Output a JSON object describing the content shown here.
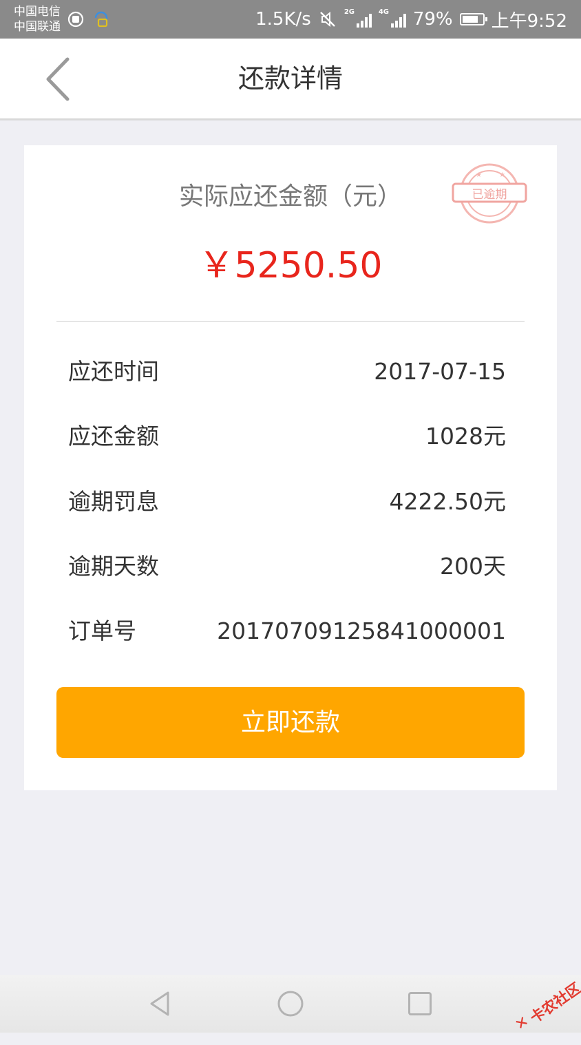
{
  "status_bar": {
    "carrier_1": "中国电信",
    "carrier_2": "中国联通",
    "speed": "1.5K/s",
    "signal_1_label": "2G",
    "signal_2_label": "4G",
    "battery_percent": "79%",
    "battery_level": 0.79,
    "time": "上午9:52"
  },
  "header": {
    "title": "还款详情",
    "back_icon": "chevron-left-icon"
  },
  "summary": {
    "label": "实际应还金额（元）",
    "amount": "￥5250.50",
    "stamp_text": "已逾期",
    "amount_color": "#e8251c"
  },
  "details": [
    {
      "label": "应还时间",
      "value": "2017-07-15"
    },
    {
      "label": "应还金额",
      "value": "1028元"
    },
    {
      "label": "逾期罚息",
      "value": "4222.50元"
    },
    {
      "label": "逾期天数",
      "value": "200天"
    },
    {
      "label": "订单号",
      "value": "20170709125841000001"
    }
  ],
  "actions": {
    "pay_label": "立即还款",
    "pay_color": "#ffa600"
  },
  "system_nav": {
    "back_icon": "triangle-back-icon",
    "home_icon": "circle-home-icon",
    "recent_icon": "square-recent-icon"
  },
  "watermark": {
    "text": "卡农社区"
  }
}
